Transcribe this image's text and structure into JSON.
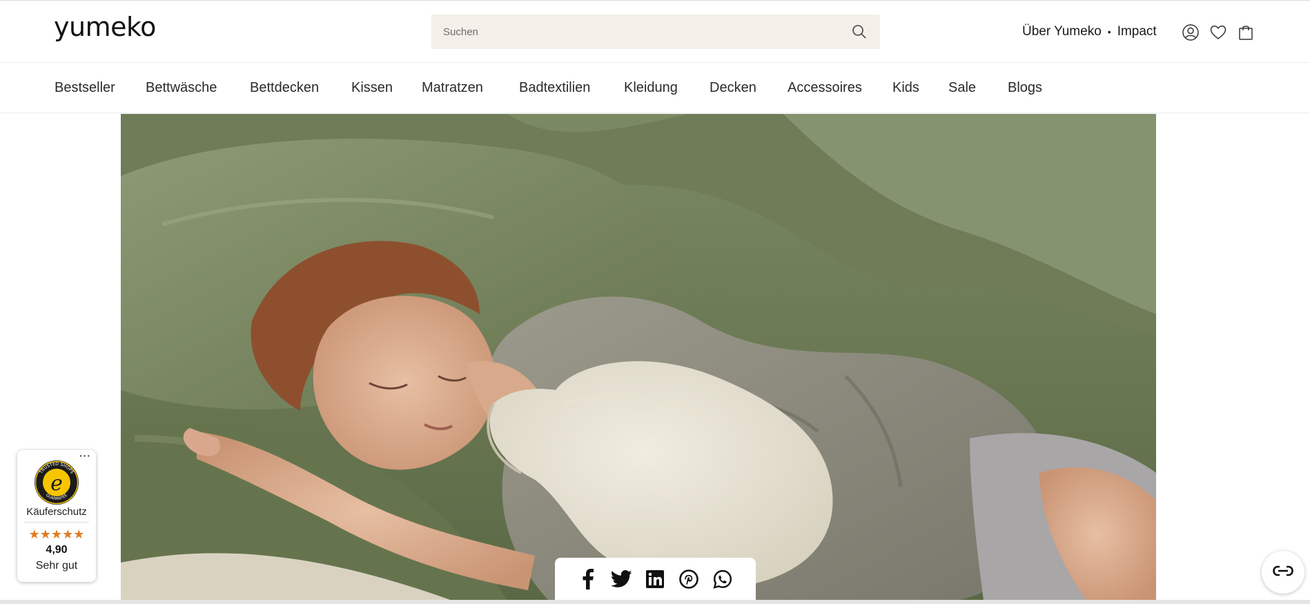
{
  "header": {
    "logo": "yumeko",
    "search": {
      "placeholder": "Suchen"
    },
    "links": [
      {
        "label": "Über Yumeko"
      },
      {
        "label": "Impact"
      }
    ],
    "separator": "•",
    "icons": [
      "account-icon",
      "wishlist-heart-icon",
      "shopping-bag-icon"
    ]
  },
  "nav": {
    "items": [
      {
        "label": "Bestseller"
      },
      {
        "label": "Bettwäsche"
      },
      {
        "label": "Bettdecken"
      },
      {
        "label": "Kissen"
      },
      {
        "label": "Matratzen"
      },
      {
        "label": "Badtextilien"
      },
      {
        "label": "Kleidung"
      },
      {
        "label": "Decken"
      },
      {
        "label": "Accessoires"
      },
      {
        "label": "Kids"
      },
      {
        "label": "Sale"
      },
      {
        "label": "Blogs"
      }
    ]
  },
  "share": {
    "icons": [
      "facebook-icon",
      "twitter-icon",
      "linkedin-icon",
      "pinterest-icon",
      "whatsapp-icon"
    ]
  },
  "trusted_shops": {
    "more": "···",
    "seal_text": "TRUSTED SHOPS · GUARANTEE",
    "label": "Käuferschutz",
    "stars": "★★★★★",
    "score": "4,90",
    "grade": "Sehr gut",
    "rating_out_of_5": 4.9
  },
  "colors": {
    "search_bg": "#f4efe9",
    "stars": "#e07a22",
    "sheet_green": "#7d8a66",
    "text": "#1f1f1f"
  }
}
